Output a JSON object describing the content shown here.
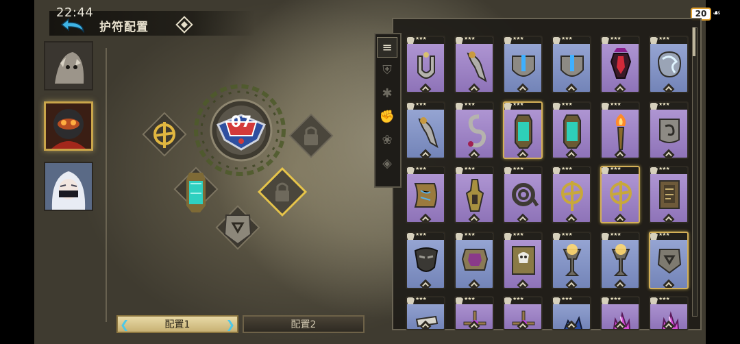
{
  "status_bar": {
    "time": "22:44",
    "battery": "20"
  },
  "header": {
    "title": "护符配置"
  },
  "wheel": {
    "badge_number": "07"
  },
  "tabs": [
    {
      "label": "配置1",
      "active": true
    },
    {
      "label": "配置2",
      "active": false
    }
  ],
  "characters": [
    {
      "name": "wolf-warrior-portrait",
      "selected": false
    },
    {
      "name": "masked-knight-portrait",
      "selected": true
    },
    {
      "name": "white-haired-girl-portrait",
      "selected": false
    }
  ],
  "filters": [
    {
      "icon": "all-filter-icon",
      "active": true
    },
    {
      "icon": "shield-class-icon",
      "active": false
    },
    {
      "icon": "claw-class-icon",
      "active": false
    },
    {
      "icon": "fist-class-icon",
      "active": false
    },
    {
      "icon": "feather-class-icon",
      "active": false
    },
    {
      "icon": "eye-class-icon",
      "active": false
    }
  ],
  "card_rows": [
    [
      {
        "item": "horseshoe-amulet",
        "bg": "purple",
        "gold": false
      },
      {
        "item": "claw-ring",
        "bg": "purple",
        "gold": false
      },
      {
        "item": "blue-crystal-horseshoe",
        "bg": "blue",
        "gold": false
      },
      {
        "item": "blue-crystal-horseshoe",
        "bg": "blue",
        "gold": false
      },
      {
        "item": "red-crystal-totem",
        "bg": "purple",
        "gold": false
      },
      {
        "item": "storm-rune-stone",
        "bg": "blue",
        "gold": false
      }
    ],
    [
      {
        "item": "claw-ring",
        "bg": "blue",
        "gold": false
      },
      {
        "item": "serpent-charm",
        "bg": "purple",
        "gold": false
      },
      {
        "item": "green-crystal-lantern",
        "bg": "purple",
        "gold": true
      },
      {
        "item": "green-crystal-lantern",
        "bg": "purple",
        "gold": false
      },
      {
        "item": "flame-torch",
        "bg": "purple",
        "gold": false
      },
      {
        "item": "spiral-stone",
        "bg": "purple",
        "gold": false
      }
    ],
    [
      {
        "item": "ancient-scroll",
        "bg": "purple",
        "gold": false
      },
      {
        "item": "oil-lamp",
        "bg": "purple",
        "gold": false
      },
      {
        "item": "coiled-whip",
        "bg": "purple",
        "gold": false
      },
      {
        "item": "golden-wheel",
        "bg": "purple",
        "gold": false
      },
      {
        "item": "golden-wheel",
        "bg": "purple",
        "gold": true
      },
      {
        "item": "carved-tablet",
        "bg": "purple",
        "gold": false
      }
    ],
    [
      {
        "item": "iron-mask",
        "bg": "blue",
        "gold": false
      },
      {
        "item": "amethyst-plate",
        "bg": "blue",
        "gold": false
      },
      {
        "item": "skull-tome",
        "bg": "purple",
        "gold": false
      },
      {
        "item": "glowing-chalice",
        "bg": "blue",
        "gold": false
      },
      {
        "item": "glowing-chalice",
        "bg": "blue",
        "gold": false
      },
      {
        "item": "stone-crest",
        "bg": "blue",
        "gold": true
      }
    ],
    [
      {
        "item": "bone-relic",
        "bg": "blue",
        "gold": false
      },
      {
        "item": "violet-cross",
        "bg": "purple",
        "gold": false
      },
      {
        "item": "violet-cross",
        "bg": "purple",
        "gold": false
      },
      {
        "item": "azure-gem-pile",
        "bg": "blue",
        "gold": false
      },
      {
        "item": "pink-crystal-cluster",
        "bg": "purple",
        "gold": false
      },
      {
        "item": "pink-crystal-cluster",
        "bg": "purple",
        "gold": false
      }
    ]
  ],
  "colors": {
    "accent_gold": "#c9a54a",
    "card_purple": "#a58bcb",
    "card_blue": "#8797c9",
    "tab_active": "#dccb92"
  }
}
